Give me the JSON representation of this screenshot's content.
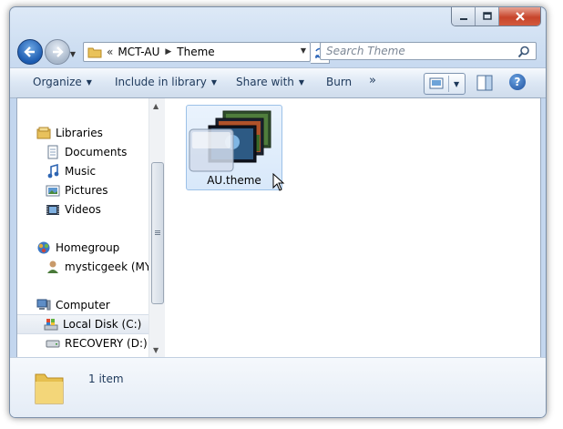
{
  "window": {
    "caption_buttons": {
      "minimize": "minimize",
      "maximize": "maximize",
      "close": "close"
    }
  },
  "address": {
    "overflow_chevron": "«",
    "crumbs": [
      "MCT-AU",
      "Theme"
    ]
  },
  "search": {
    "placeholder": "Search Theme"
  },
  "toolbar": {
    "organize": "Organize",
    "include_in_library": "Include in library",
    "share_with": "Share with",
    "burn": "Burn",
    "more": "»"
  },
  "nav": {
    "libraries": "Libraries",
    "documents": "Documents",
    "music": "Music",
    "pictures": "Pictures",
    "videos": "Videos",
    "homegroup": "Homegroup",
    "user": "mysticgeek (MYS",
    "computer": "Computer",
    "local_disk": "Local Disk (C:)",
    "recovery": "RECOVERY (D:)"
  },
  "files": [
    {
      "name": "AU.theme"
    }
  ],
  "status": {
    "item_count": "1 item"
  },
  "colors": {
    "accent": "#1c5bb0",
    "toolbar_text": "#1e395b",
    "selection_border": "#9cc1e8"
  }
}
